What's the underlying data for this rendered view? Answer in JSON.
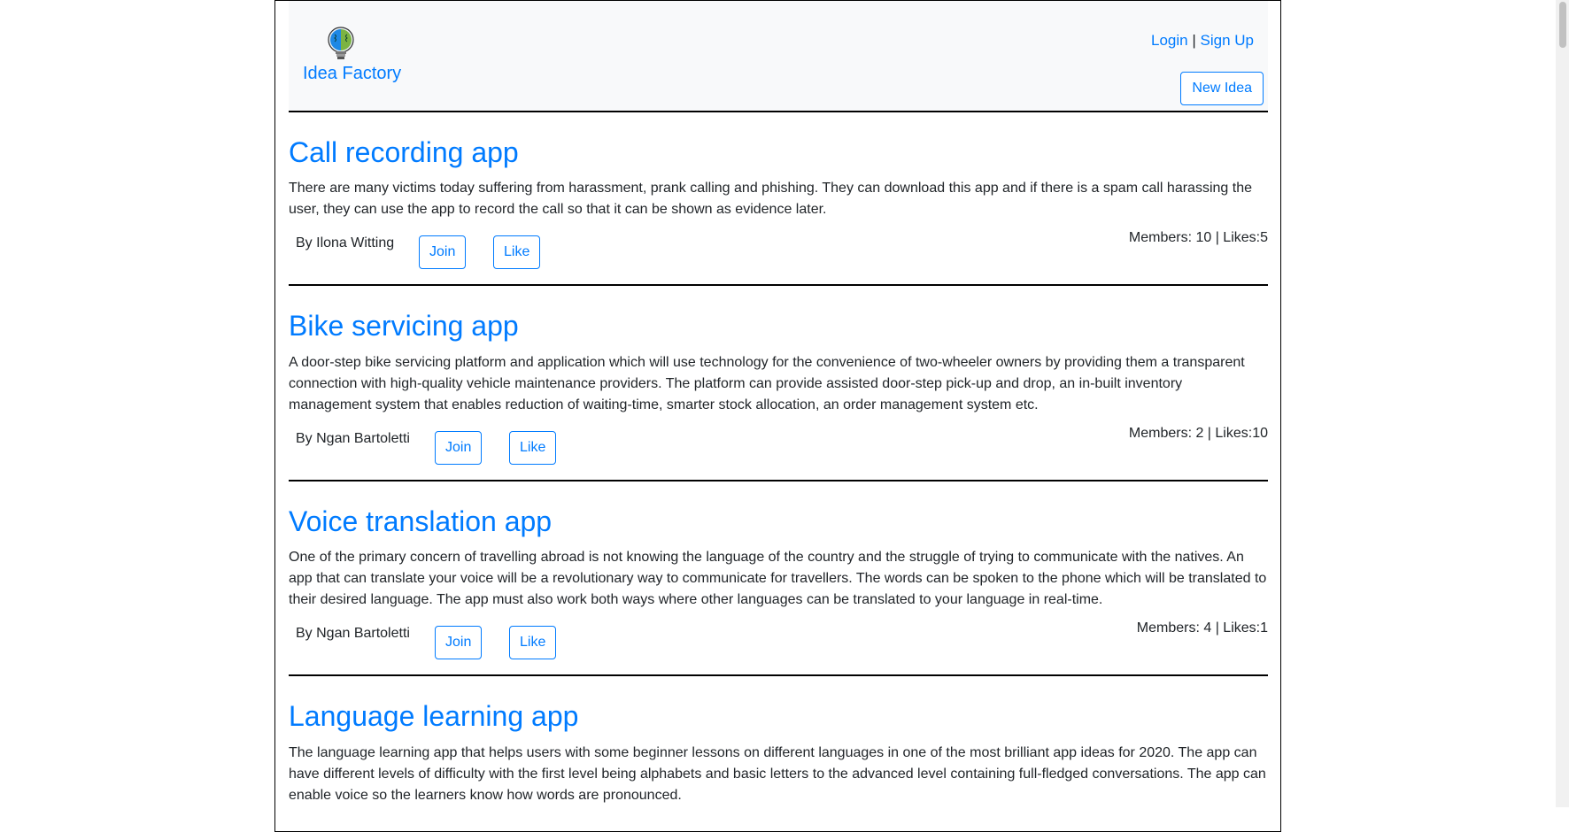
{
  "header": {
    "brand": "Idea Factory",
    "login": "Login",
    "separator": "|",
    "signup": "Sign Up",
    "new_idea": "New Idea",
    "logo_icon": "lightbulb-brain-icon"
  },
  "ideas": [
    {
      "title": "Call recording app",
      "description": "There are many victims today suffering from harassment, prank calling and phishing. They can download this app and if there is a spam call harassing the user, they can use the app to record the call so that it can be shown as evidence later.",
      "author": "By Ilona Witting",
      "join": "Join",
      "like": "Like",
      "stats": "Members: 10 | Likes:5"
    },
    {
      "title": "Bike servicing app",
      "description": "A door-step bike servicing platform and application which will use technology for the convenience of two-wheeler owners by providing them a transparent connection with high-quality vehicle maintenance providers. The platform can provide assisted door-step pick-up and drop, an in-built inventory management system that enables reduction of waiting-time, smarter stock allocation, an order management system etc.",
      "author": "By Ngan Bartoletti",
      "join": "Join",
      "like": "Like",
      "stats": "Members: 2 | Likes:10"
    },
    {
      "title": "Voice translation app",
      "description": "One of the primary concern of travelling abroad is not knowing the language of the country and the struggle of trying to communicate with the natives. An app that can translate your voice will be a revolutionary way to communicate for travellers. The words can be spoken to the phone which will be translated to their desired language. The app must also work both ways where other languages can be translated to your language in real-time.",
      "author": "By Ngan Bartoletti",
      "join": "Join",
      "like": "Like",
      "stats": "Members: 4 | Likes:1"
    },
    {
      "title": "Language learning app",
      "description": "The language learning app that helps users with some beginner lessons on different languages in one of the most brilliant app ideas for 2020. The app can have different levels of difficulty with the first level being alphabets and basic letters to the advanced level containing full-fledged conversations. The app can enable voice so the learners know how words are pronounced."
    }
  ]
}
